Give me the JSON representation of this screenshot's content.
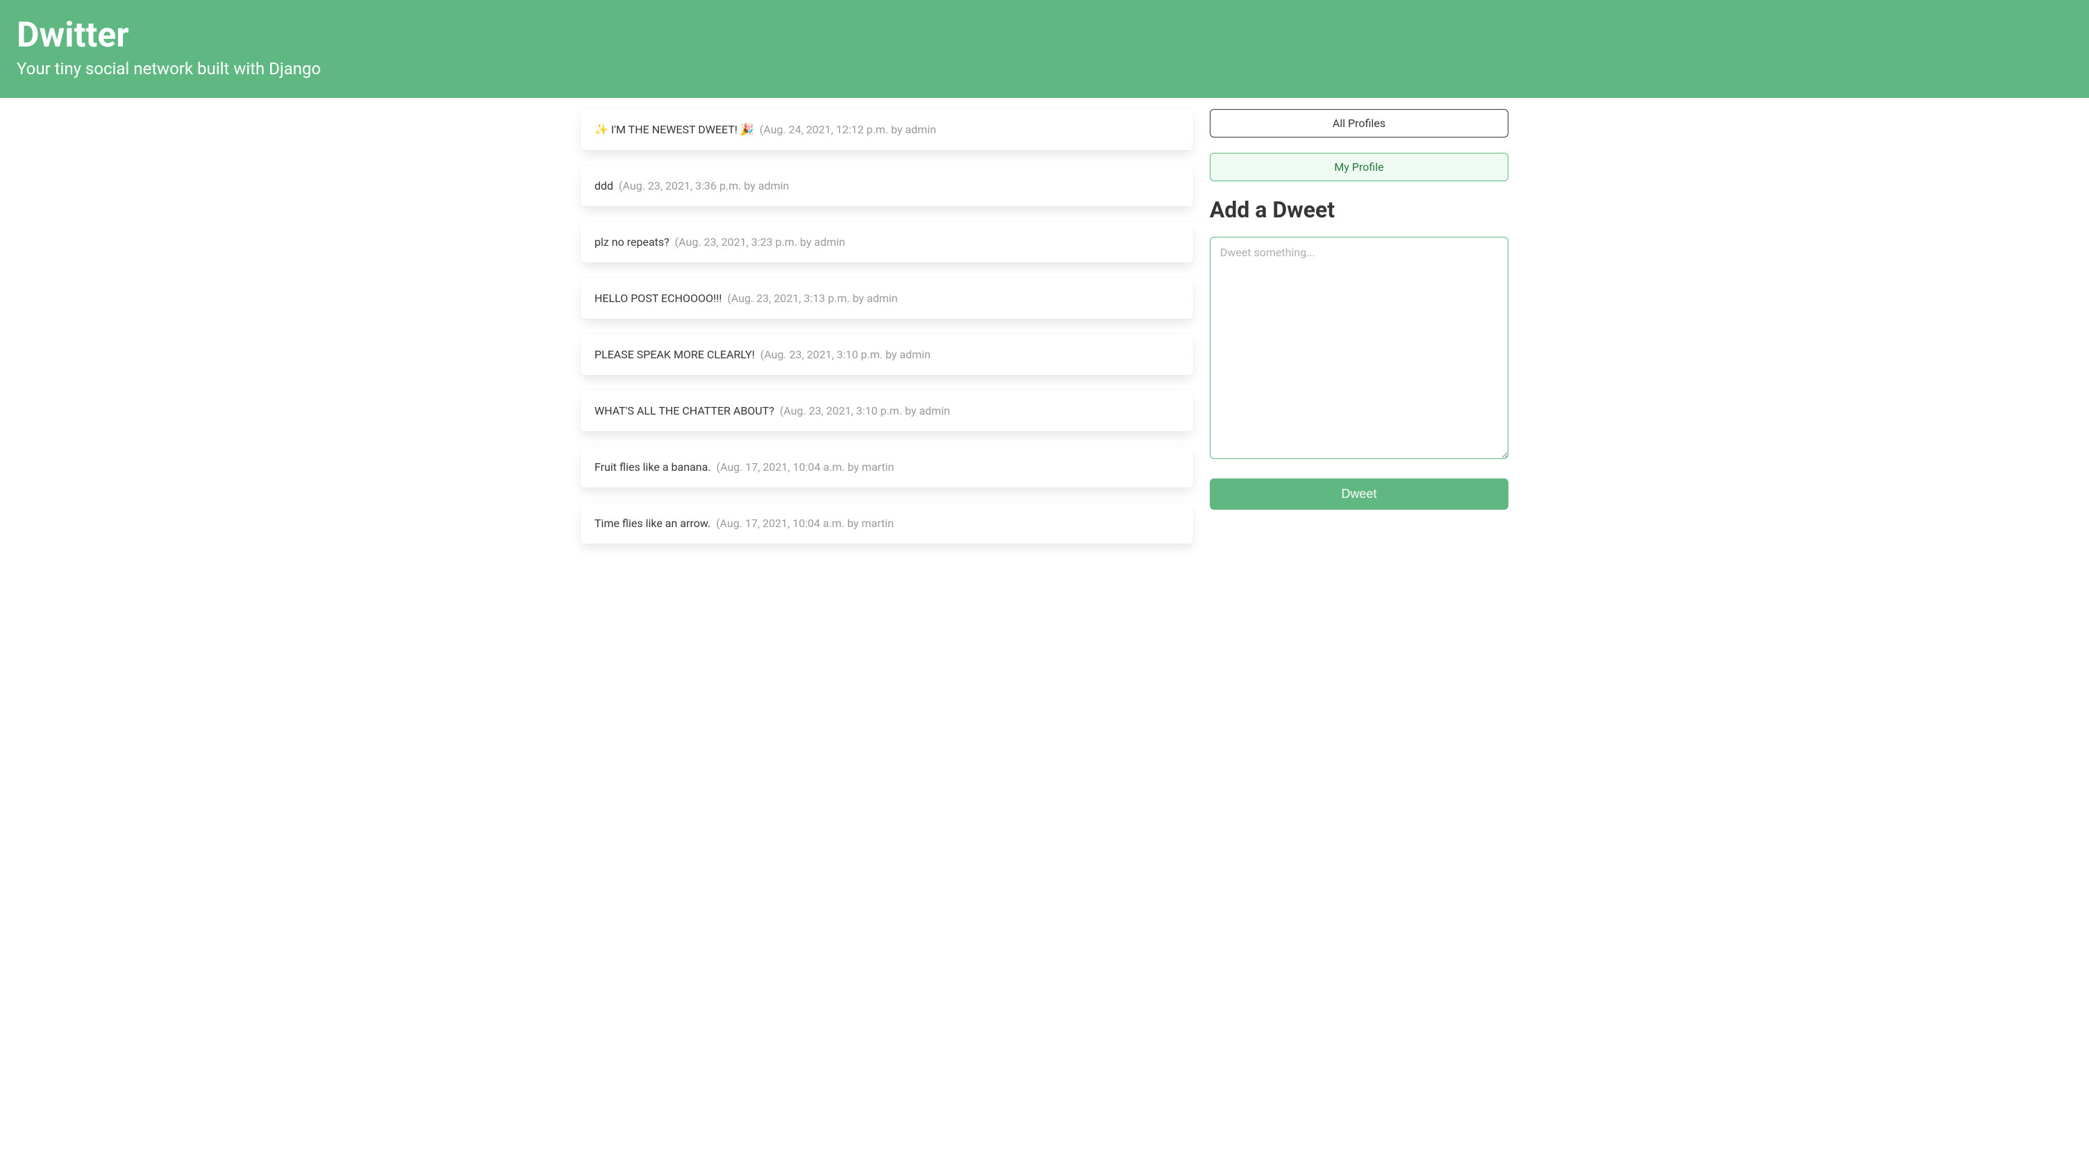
{
  "hero": {
    "title": "Dwitter",
    "subtitle": "Your tiny social network built with Django"
  },
  "sidebar": {
    "all_profiles_label": "All Profiles",
    "my_profile_label": "My Profile"
  },
  "dweets": [
    {
      "body": "✨ I'M THE NEWEST DWEET! 🎉",
      "meta": "(Aug. 24, 2021, 12:12 p.m. by admin"
    },
    {
      "body": "ddd",
      "meta": "(Aug. 23, 2021, 3:36 p.m. by admin"
    },
    {
      "body": "plz no repeats?",
      "meta": "(Aug. 23, 2021, 3:23 p.m. by admin"
    },
    {
      "body": "HELLO POST ECHOOOO!!!",
      "meta": "(Aug. 23, 2021, 3:13 p.m. by admin"
    },
    {
      "body": "PLEASE SPEAK MORE CLEARLY!",
      "meta": "(Aug. 23, 2021, 3:10 p.m. by admin"
    },
    {
      "body": "WHAT'S ALL THE CHATTER ABOUT?",
      "meta": "(Aug. 23, 2021, 3:10 p.m. by admin"
    },
    {
      "body": "Fruit flies like a banana.",
      "meta": "(Aug. 17, 2021, 10:04 a.m. by martin"
    },
    {
      "body": "Time flies like an arrow.",
      "meta": "(Aug. 17, 2021, 10:04 a.m. by martin"
    }
  ],
  "form": {
    "title": "Add a Dweet",
    "placeholder": "Dweet something...",
    "submit_label": "Dweet"
  }
}
